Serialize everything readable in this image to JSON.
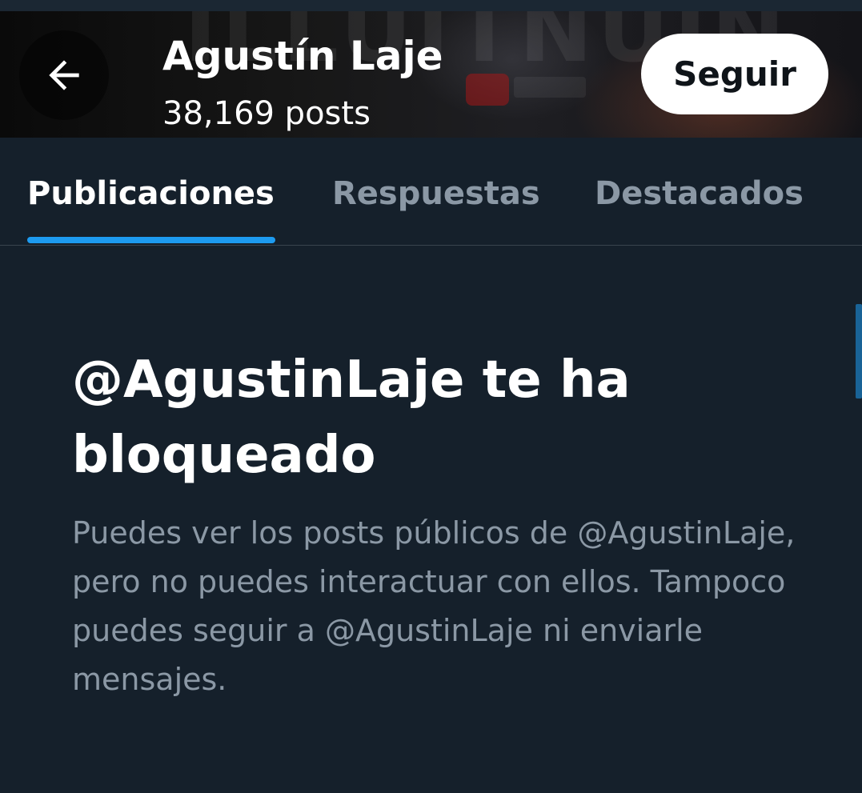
{
  "header": {
    "profile_name": "Agustín Laje",
    "post_count": "38,169 posts",
    "follow_label": "Seguir"
  },
  "tabs": [
    {
      "label": "Publicaciones",
      "active": true
    },
    {
      "label": "Respuestas",
      "active": false
    },
    {
      "label": "Destacados",
      "active": false
    }
  ],
  "blocked_notice": {
    "title": "@AgustinLaje te ha bloqueado",
    "body": "Puedes ver los posts públicos de @AgustinLaje, pero no puedes interactuar con ellos. Tampoco puedes seguir a @AgustinLaje ni enviarle mensajes."
  },
  "colors": {
    "background": "#15202b",
    "accent": "#1d9bf0",
    "secondary_text": "#8b98a5",
    "primary_text": "#ffffff"
  },
  "icons": {
    "back": "arrow-left-icon"
  }
}
